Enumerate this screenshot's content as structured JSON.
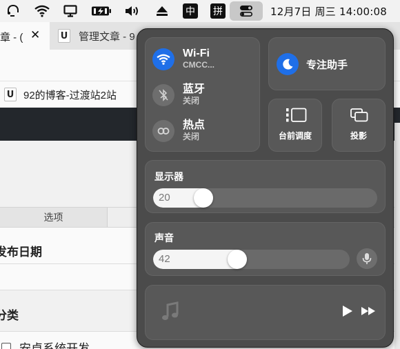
{
  "menubar": {
    "icons": [
      "headset-icon",
      "wifi-icon",
      "monitor-icon",
      "battery-charging-icon",
      "volume-icon",
      "eject-icon"
    ],
    "ime_zh": "中",
    "ime_pinyin": "拼",
    "control_center_icon": "toggles-icon",
    "clock": "12月7日 周三 14:00:08"
  },
  "browser": {
    "active_tab_title": "章 - (",
    "tab2_favicon": "U",
    "tab2_title": "管理文章 - 9",
    "bookmark_favicon": "U",
    "bookmark_title": "92的博客-过渡站2站",
    "table_header": "选项",
    "field_publish_date": "发布日期",
    "field_category": "分类",
    "category_option": "安卓系统开发"
  },
  "control_center": {
    "wifi": {
      "title": "Wi-Fi",
      "subtitle": "CMCC...",
      "icon": "wifi-icon",
      "accent": "#1f6fe8"
    },
    "bluetooth": {
      "title": "蓝牙",
      "subtitle": "关闭",
      "icon": "bluetooth-icon"
    },
    "hotspot": {
      "title": "热点",
      "subtitle": "关闭",
      "icon": "hotspot-icon"
    },
    "focus": {
      "label": "专注助手",
      "icon": "moon-icon"
    },
    "stage_manager": {
      "label": "台前调度",
      "icon": "stage-manager-icon"
    },
    "screen_mirroring": {
      "label": "投影",
      "icon": "screen-mirroring-icon"
    },
    "display": {
      "label": "显示器",
      "value": 20
    },
    "sound": {
      "label": "声音",
      "value": 42
    },
    "media": {
      "icons": [
        "music-note-icon",
        "play-icon",
        "fast-forward-icon"
      ]
    }
  }
}
